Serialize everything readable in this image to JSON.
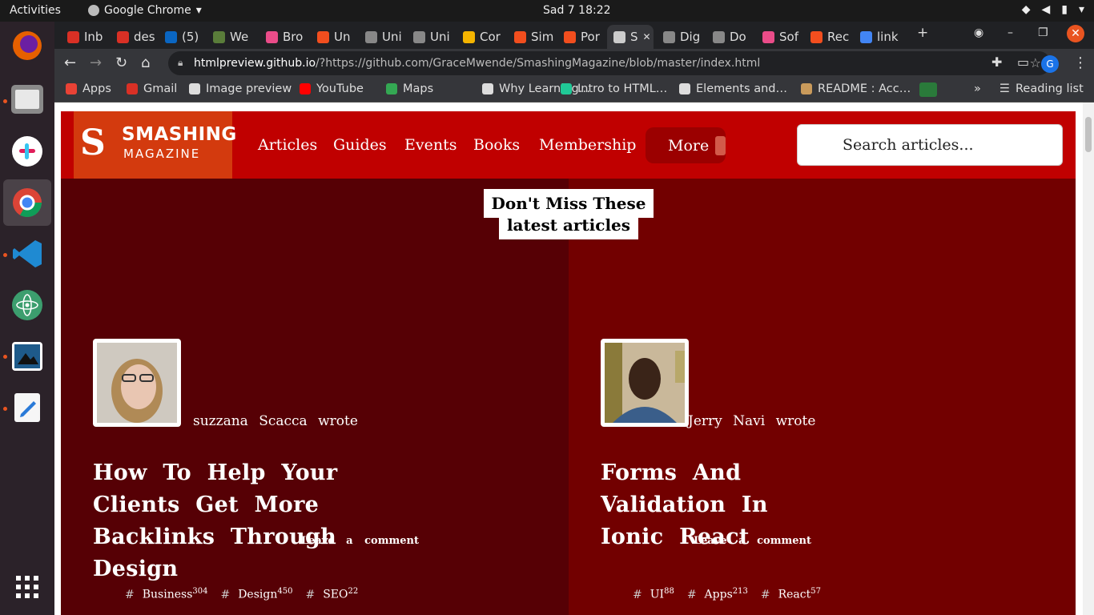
{
  "system": {
    "activities": "Activities",
    "app_name": "Google Chrome",
    "clock": "Sad 7  18:22"
  },
  "tabs": [
    {
      "label": "Inb",
      "icon": "gmail-icon",
      "color": "#d93025"
    },
    {
      "label": "des",
      "icon": "gmail-icon",
      "color": "#d93025"
    },
    {
      "label": "(5)",
      "icon": "linkedin-icon",
      "color": "#0a66c2"
    },
    {
      "label": "We",
      "icon": "tree-icon",
      "color": "#5a7d3a"
    },
    {
      "label": "Bro",
      "icon": "dribbble-icon",
      "color": "#ea4c89"
    },
    {
      "label": "Un",
      "icon": "figma-icon",
      "color": "#f24e1e"
    },
    {
      "label": "Uni",
      "icon": "globe-icon",
      "color": "#888888"
    },
    {
      "label": "Uni",
      "icon": "globe-icon",
      "color": "#888888"
    },
    {
      "label": "Cor",
      "icon": "colorful-icon",
      "color": "#f4b400"
    },
    {
      "label": "Sim",
      "icon": "figma-icon",
      "color": "#f24e1e"
    },
    {
      "label": "Por",
      "icon": "figma-icon",
      "color": "#f24e1e"
    },
    {
      "label": "S",
      "icon": "globe-icon",
      "color": "#cccccc"
    },
    {
      "label": "Dig",
      "icon": "globe-icon",
      "color": "#888888"
    },
    {
      "label": "Do",
      "icon": "globe-icon",
      "color": "#888888"
    },
    {
      "label": "Sof",
      "icon": "dribbble-icon",
      "color": "#ea4c89"
    },
    {
      "label": "Rec",
      "icon": "figma-icon",
      "color": "#f24e1e"
    },
    {
      "label": "link",
      "icon": "google-icon",
      "color": "#4285f4"
    }
  ],
  "omnibox": {
    "host": "htmlpreview.github.io",
    "rest": "/?https://github.com/GraceMwende/SmashingMagazine/blob/master/index.html"
  },
  "bookmarks": [
    {
      "label": "Apps",
      "icon": "apps-grid-icon",
      "color": "#e94235"
    },
    {
      "label": "Gmail",
      "icon": "gmail-icon",
      "color": "#d93025"
    },
    {
      "label": "Image preview",
      "icon": "globe-icon",
      "color": "#dddddd"
    },
    {
      "label": "YouTube",
      "icon": "youtube-icon",
      "color": "#ff0000"
    },
    {
      "label": "Maps",
      "icon": "maps-pin-icon",
      "color": "#34a853"
    },
    {
      "label": "Why Learning…",
      "icon": "page-icon",
      "color": "#dddddd"
    },
    {
      "label": "Intro to HTML…",
      "icon": "hex-icon",
      "color": "#20c997"
    },
    {
      "label": "Elements and…",
      "icon": "doc-icon",
      "color": "#dddddd"
    },
    {
      "label": "README : Acc…",
      "icon": "tree-icon",
      "color": "#c99a5b"
    }
  ],
  "reading_list": "Reading list",
  "site": {
    "logo_line1": "SMASHING",
    "logo_line2": "MAGAZINE",
    "nav": [
      "Articles",
      "Guides",
      "Events",
      "Books",
      "Membership"
    ],
    "more": "More",
    "search_placeholder": "Search articles...",
    "banner": "Don't Miss These latest articles"
  },
  "articles": [
    {
      "author": "suzzana Scacca wrote",
      "title": "How To Help Your Clients Get More Backlinks Through Design",
      "comment": "Leave a comment",
      "tags": [
        {
          "name": "Business",
          "count": "304"
        },
        {
          "name": "Design",
          "count": "450"
        },
        {
          "name": "SEO",
          "count": "22"
        }
      ]
    },
    {
      "author": "Jerry Navi wrote",
      "title": "Forms And Validation In Ionic React",
      "comment": "Leave a comment",
      "tags": [
        {
          "name": "UI",
          "count": "88"
        },
        {
          "name": "Apps",
          "count": "213"
        },
        {
          "name": "React",
          "count": "57"
        }
      ]
    }
  ]
}
